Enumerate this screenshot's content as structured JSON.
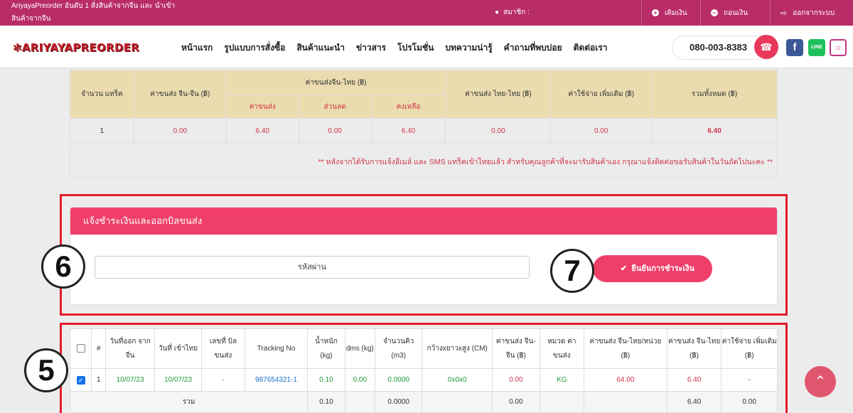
{
  "topbar": {
    "tagline": "AriyayaPreorder อันดับ 1 สั่งสินค้าจากจีน และ นำเข้าสินค้าจากจีน",
    "member_label": "สมาชิก :",
    "topup_label": "เติมเงิน",
    "withdraw_label": "ถอนเงิน",
    "logout_label": "ออกจากระบบ"
  },
  "navbar": {
    "logo": "ARIYAYAPREORDER",
    "menu": [
      "หน้าแรก",
      "รูปแบบการสั่งซื้อ",
      "สินค้าแนะนำ",
      "ข่าวสาร",
      "โปรโมชั่น",
      "บทความน่ารู้",
      "คำถามที่พบบ่อย",
      "ติดต่อเรา"
    ],
    "phone": "080-003-8383"
  },
  "summary": {
    "headers": {
      "crates": "จำนวน แทร็ค",
      "cn_cn": "ค่าขนส่ง จีน-จีน (฿)",
      "cn_th_group": "ค่าขนส่งจีน-ไทย (฿)",
      "shipping": "ค่าขนส่ง",
      "discount": "ส่วนลด",
      "remaining": "คงเหลือ",
      "th_th": "ค่าขนส่ง ไทย-ไทย (฿)",
      "extra": "ค่าใช้จ่าย เพิ่มเติม (฿)",
      "total": "รวมทั้งหมด (฿)"
    },
    "row": {
      "crates": "1",
      "cn_cn": "0.00",
      "shipping": "6.40",
      "discount": "0.00",
      "remaining": "6.40",
      "th_th": "0.00",
      "extra": "0.00",
      "total": "6.40"
    },
    "note": "** หลังจากได้รับการแจ้งอีเมล์ และ SMS แทร็คเข้าไทยแล้ว สำหรับคุณลูกค้าที่จะมารับสินค้าเอง กรุณาแจ้งติดต่อขอรับสินค้าในวันถัดไปนะคะ **"
  },
  "payment_panel": {
    "title": "แจ้งชำระเงินและออกบิลขนส่ง",
    "password_placeholder": "รหัสผ่าน",
    "confirm_label": "ยืนยันการชำระเงิน"
  },
  "callouts": {
    "five": "5",
    "six": "6",
    "seven": "7"
  },
  "parcels": {
    "headers": [
      "#",
      "วันที่ออก จากจีน",
      "วันที่ เข้าไทย",
      "เลขที่ บิลขนส่ง",
      "Tracking No",
      "น้ำหนัก (kg)",
      "dms (kg)",
      "จำนวนคิว (m3)",
      "กว้างxยาวxสูง (CM)",
      "ค่าขนส่ง จีน-จีน (฿)",
      "หมวด ค่าขนส่ง",
      "ค่าขนส่ง จีน-ไทย/หน่วย (฿)",
      "ค่าขนส่ง จีน-ไทย (฿)",
      "ค่าใช้จ่าย เพิ่มเติม (฿)"
    ],
    "row": {
      "no": "1",
      "cn_date": "10/07/23",
      "th_date": "10/07/23",
      "bill": "-",
      "tracking": "987654321-1",
      "weight": "0.10",
      "dms": "0.00",
      "cbm": "0.0000",
      "dims": "0x0x0",
      "cn_cn": "0.00",
      "category": "KG",
      "unit_rate": "64.00",
      "cn_th": "6.40",
      "extra": "-"
    },
    "sum": {
      "label": "รวม",
      "weight": "0.10",
      "cbm": "0.0000",
      "cn_cn": "0.00",
      "cn_th": "6.40",
      "extra": "0.00"
    }
  },
  "colors": {
    "primary": "#ef3f69",
    "topbar": "#b82c67",
    "annotation": "#e31c2d"
  }
}
